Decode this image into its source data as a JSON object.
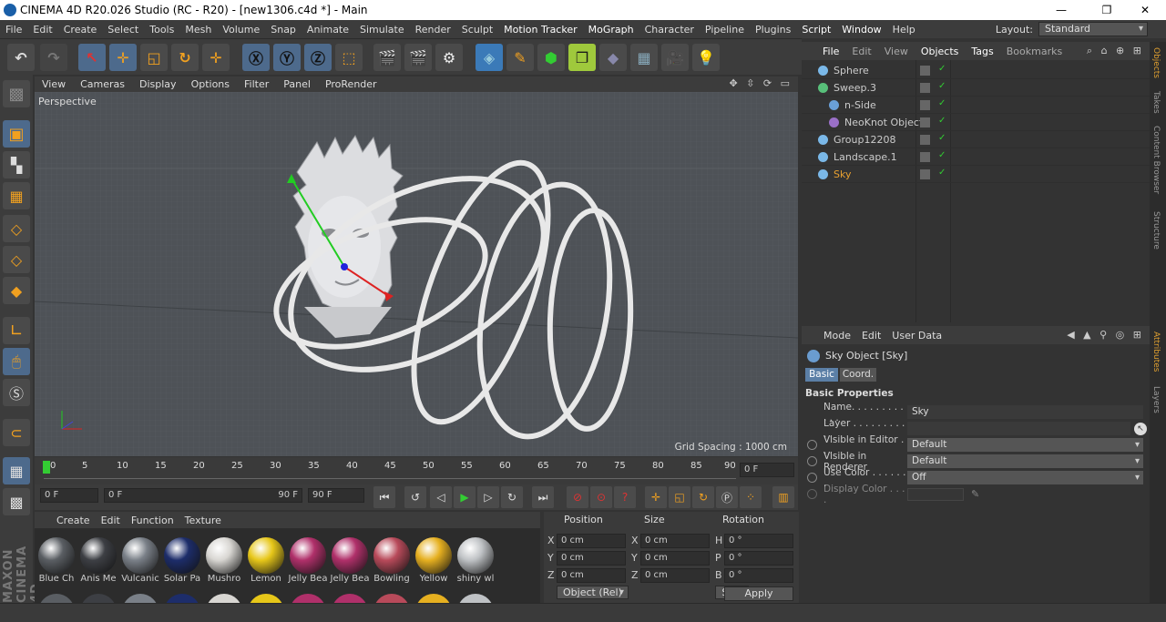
{
  "window": {
    "title": "CINEMA 4D R20.026 Studio (RC - R20) - [new1306.c4d *] - Main",
    "minimize": "—",
    "maximize": "❐",
    "close": "✕"
  },
  "menubar": {
    "items": [
      "File",
      "Edit",
      "Create",
      "Select",
      "Tools",
      "Mesh",
      "Volume",
      "Snap",
      "Animate",
      "Simulate",
      "Render",
      "Sculpt",
      "Motion Tracker",
      "MoGraph",
      "Character",
      "Pipeline",
      "Plugins",
      "Script",
      "Window",
      "Help"
    ],
    "layout_label": "Layout:",
    "layout_value": "Standard"
  },
  "viewport": {
    "menu": [
      "View",
      "Cameras",
      "Display",
      "Options",
      "Filter",
      "Panel",
      "ProRender"
    ],
    "label": "Perspective",
    "grid_spacing": "Grid Spacing : 1000 cm"
  },
  "timeline": {
    "ticks": [
      "0",
      "5",
      "10",
      "15",
      "20",
      "25",
      "30",
      "35",
      "40",
      "45",
      "50",
      "55",
      "60",
      "65",
      "70",
      "75",
      "80",
      "85",
      "90"
    ],
    "current_frame": "0 F"
  },
  "transport": {
    "start": "0 F",
    "range_start": "0 F",
    "range_end": "90 F",
    "end": "90 F"
  },
  "materials": {
    "menu": [
      "Create",
      "Edit",
      "Function",
      "Texture"
    ],
    "items": [
      {
        "name": "Blue Ch",
        "color": "#5a5e63"
      },
      {
        "name": "Anis Me",
        "color": "#3d3f44"
      },
      {
        "name": "Vulcanic",
        "color": "#7a8088"
      },
      {
        "name": "Solar Pa",
        "color": "#1d2d6a"
      },
      {
        "name": "Mushro",
        "color": "#d8d6d2"
      },
      {
        "name": "Lemon",
        "color": "#e7c719"
      },
      {
        "name": "Jelly Bea",
        "color": "#b0306a"
      },
      {
        "name": "Jelly Bea",
        "color": "#b0306a"
      },
      {
        "name": "Bowling",
        "color": "#b84a5a"
      },
      {
        "name": "Yellow",
        "color": "#e6b020"
      },
      {
        "name": "shiny wl",
        "color": "#bfc2c5"
      }
    ]
  },
  "coords": {
    "headers": [
      "Position",
      "Size",
      "Rotation"
    ],
    "rows": [
      {
        "a": "X",
        "pos": "0 cm",
        "b": "X",
        "size": "0 cm",
        "c": "H",
        "rot": "0 °"
      },
      {
        "a": "Y",
        "pos": "0 cm",
        "b": "Y",
        "size": "0 cm",
        "c": "P",
        "rot": "0 °"
      },
      {
        "a": "Z",
        "pos": "0 cm",
        "b": "Z",
        "size": "0 cm",
        "c": "B",
        "rot": "0 °"
      }
    ],
    "mode": "Object (Rel)",
    "size_mode": "Size",
    "apply": "Apply"
  },
  "objects": {
    "menu": [
      "File",
      "Edit",
      "View",
      "Objects",
      "Tags",
      "Bookmarks"
    ],
    "items": [
      {
        "name": "Sphere",
        "indent": 0,
        "highlight": false
      },
      {
        "name": "Sweep.3",
        "indent": 0,
        "highlight": false
      },
      {
        "name": "n-Side",
        "indent": 1,
        "highlight": false
      },
      {
        "name": "NeoKnot Object",
        "indent": 1,
        "highlight": false
      },
      {
        "name": "Group12208",
        "indent": 0,
        "highlight": false
      },
      {
        "name": "Landscape.1",
        "indent": 0,
        "highlight": false
      },
      {
        "name": "Sky",
        "indent": 0,
        "highlight": true
      }
    ]
  },
  "attributes": {
    "menu": [
      "Mode",
      "Edit",
      "User Data"
    ],
    "object_title": "Sky Object [Sky]",
    "tabs": [
      "Basic",
      "Coord."
    ],
    "section": "Basic Properties",
    "props": [
      {
        "label": "Name. . . . . . . . . . . .",
        "value": "Sky"
      },
      {
        "label": "Layer . . . . . . . . . . .",
        "value": ""
      },
      {
        "label": "Visible in Editor . . .",
        "value": "Default"
      },
      {
        "label": "Visible in Renderer",
        "value": "Default"
      },
      {
        "label": "Use Color . . . . . . .",
        "value": "Off"
      },
      {
        "label": "Display Color . . . .",
        "value": ""
      }
    ]
  },
  "side_tabs": [
    "Objects",
    "Takes",
    "Content Browser",
    "Structure",
    "Attributes",
    "Layers"
  ],
  "brand": {
    "text": "MAXON CINEMA 4D"
  }
}
